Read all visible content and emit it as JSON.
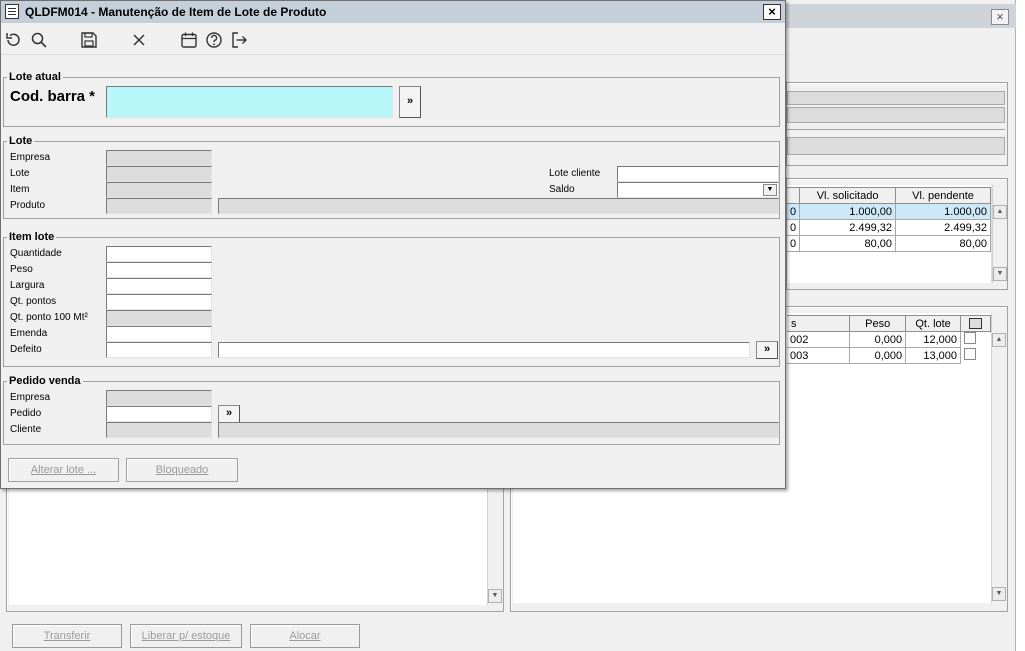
{
  "dialog": {
    "title": "QLDFM014 - Manutenção de Item de Lote de Produto",
    "close": "×",
    "toolbar": {
      "undo_icon": "undo-icon",
      "search_icon": "search-icon",
      "save_icon": "save-icon",
      "cancel_icon": "x-icon",
      "calendar_icon": "calendar-icon",
      "help_icon": "help-icon",
      "exit_icon": "exit-icon"
    },
    "lote_atual": {
      "legend": "Lote atual",
      "cod_barra_label": "Cod. barra *",
      "cod_barra_value": "",
      "lookup": "»"
    },
    "lote": {
      "legend": "Lote",
      "empresa_label": "Empresa",
      "lote_label": "Lote",
      "item_label": "Item",
      "produto_label": "Produto",
      "lote_cliente_label": "Lote cliente",
      "saldo_label": "Saldo"
    },
    "item_lote": {
      "legend": "Item lote",
      "quantidade_label": "Quantidade",
      "peso_label": "Peso",
      "largura_label": "Largura",
      "qt_pontos_label": "Qt. pontos",
      "qt_ponto_100_label": "Qt. ponto 100 Mt²",
      "emenda_label": "Emenda",
      "defeito_label": "Defeito",
      "lookup": "»"
    },
    "pedido_venda": {
      "legend": "Pedido venda",
      "empresa_label": "Empresa",
      "pedido_label": "Pedido",
      "cliente_label": "Cliente",
      "lookup": "»"
    },
    "buttons": {
      "alterar_lote": "Alterar lote ...",
      "bloqueado": "Bloqueado"
    }
  },
  "background": {
    "close": "×",
    "grid1": {
      "headers": [
        "Vl. solicitado",
        "Vl. pendente"
      ],
      "rows": [
        {
          "c0": "0",
          "solicitado": "1.000,00",
          "pendente": "1.000,00",
          "selected": true
        },
        {
          "c0": "0",
          "solicitado": "2.499,32",
          "pendente": "2.499,32",
          "selected": false
        },
        {
          "c0": "0",
          "solicitado": "80,00",
          "pendente": "80,00",
          "selected": false
        }
      ]
    },
    "grid2": {
      "headers": [
        "s",
        "Peso",
        "Qt. lote"
      ],
      "rows": [
        {
          "c0": "002",
          "peso": "0,000",
          "qt_lote": "12,000"
        },
        {
          "c0": "003",
          "peso": "0,000",
          "qt_lote": "13,000"
        }
      ]
    },
    "buttons": {
      "transferir": "Transferir",
      "liberar": "Liberar p/ estoque",
      "alocar": "Alocar"
    }
  }
}
